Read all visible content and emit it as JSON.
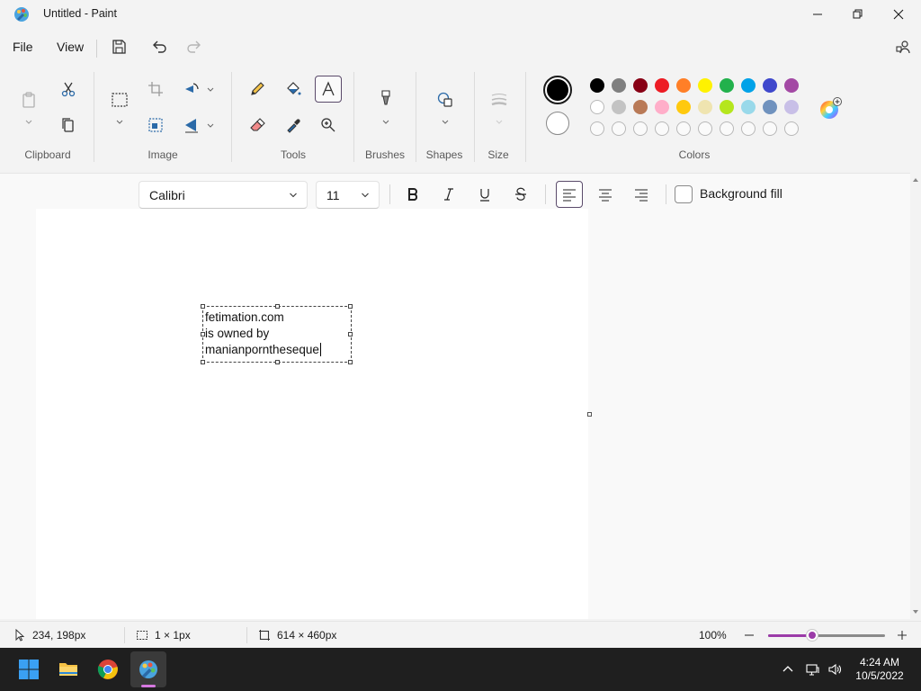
{
  "window": {
    "title": "Untitled - Paint"
  },
  "menu": {
    "file": "File",
    "view": "View"
  },
  "ribbon": {
    "groups": {
      "clipboard": "Clipboard",
      "image": "Image",
      "tools": "Tools",
      "brushes": "Brushes",
      "shapes": "Shapes",
      "size": "Size",
      "colors": "Colors"
    },
    "primary_color": "#000000",
    "secondary_color": "#ffffff",
    "palette_row1": [
      "#000000",
      "#7f7f7f",
      "#880015",
      "#ed1c24",
      "#ff7f27",
      "#fff200",
      "#22b14c",
      "#00a2e8",
      "#3f48cc",
      "#a349a4"
    ],
    "palette_row2": [
      "#ffffff",
      "#c3c3c3",
      "#b97a57",
      "#ffaec9",
      "#ffc90e",
      "#efe4b0",
      "#b5e61d",
      "#99d9ea",
      "#7092be",
      "#c8bfe7"
    ]
  },
  "text_toolbar": {
    "font": "Calibri",
    "size": "11",
    "background_fill": "Background fill"
  },
  "canvas": {
    "text_lines": [
      "fetimation.com",
      "is owned by",
      "manianporntheseque"
    ]
  },
  "status": {
    "cursor_position": "234, 198px",
    "selection_size": "1 × 1px",
    "canvas_size": "614 × 460px",
    "zoom": "100%",
    "zoom_fraction": 0.38
  },
  "taskbar": {
    "time": "4:24 AM",
    "date": "10/5/2022"
  },
  "accent_color": "#9b3ba8"
}
